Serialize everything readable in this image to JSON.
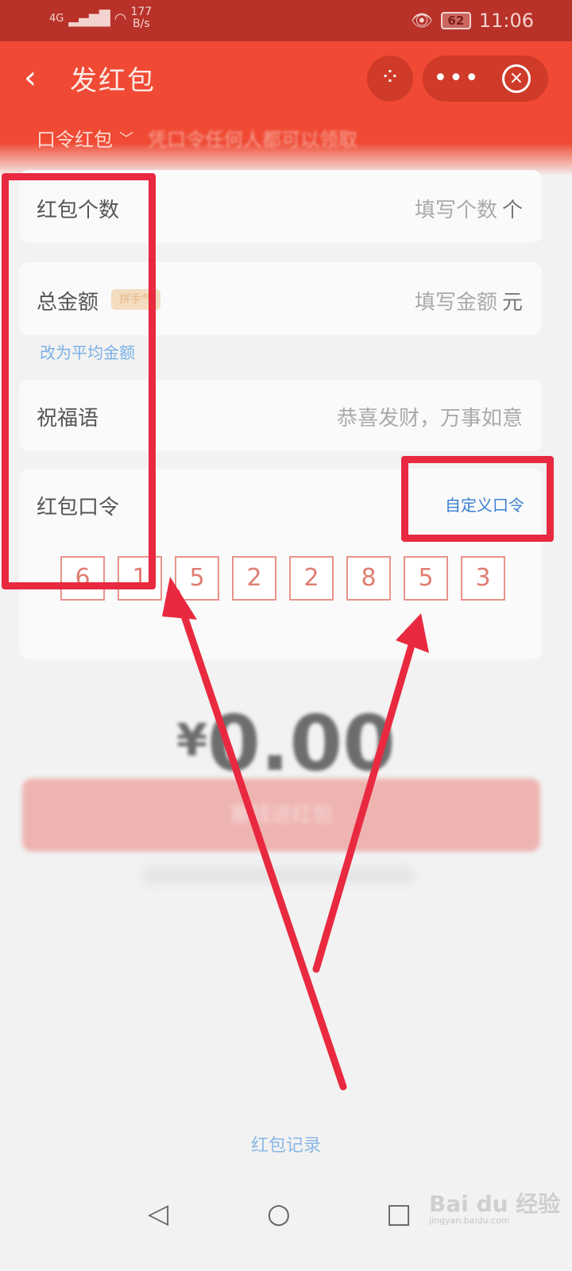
{
  "status_bar": {
    "network": "4G",
    "speed_value": "177",
    "speed_unit": "B/s",
    "battery": "62",
    "time": "11:06"
  },
  "header": {
    "title": "发红包",
    "back_icon": "‹",
    "more_icon": "•••",
    "close_icon": "×",
    "type_label": "口令红包",
    "type_desc": "凭口令任何人都可以领取"
  },
  "form": {
    "count": {
      "label": "红包个数",
      "placeholder": "填写个数",
      "unit": "个"
    },
    "amount": {
      "label": "总金额",
      "badge": "拼手气",
      "placeholder": "填写金额",
      "unit": "元"
    },
    "average_link": "改为平均金额",
    "greeting": {
      "label": "祝福语",
      "placeholder": "恭喜发财，万事如意"
    },
    "code": {
      "label": "红包口令",
      "custom_link": "自定义口令",
      "digits": [
        "6",
        "1",
        "5",
        "2",
        "2",
        "8",
        "5",
        "3"
      ]
    }
  },
  "total": {
    "currency": "¥",
    "value": "0.00"
  },
  "send_button": "塞钱进红包",
  "records_link": "红包记录",
  "navbar": {
    "back": "◁",
    "home": "○",
    "recents": "□"
  },
  "watermark": {
    "brand": "Bai du 经验",
    "url": "jingyan.baidu.com"
  },
  "colors": {
    "header_red": "#f04a34",
    "highlight": "#e8293f",
    "link_blue": "#3a7fd0",
    "code_border": "#e8938a"
  }
}
